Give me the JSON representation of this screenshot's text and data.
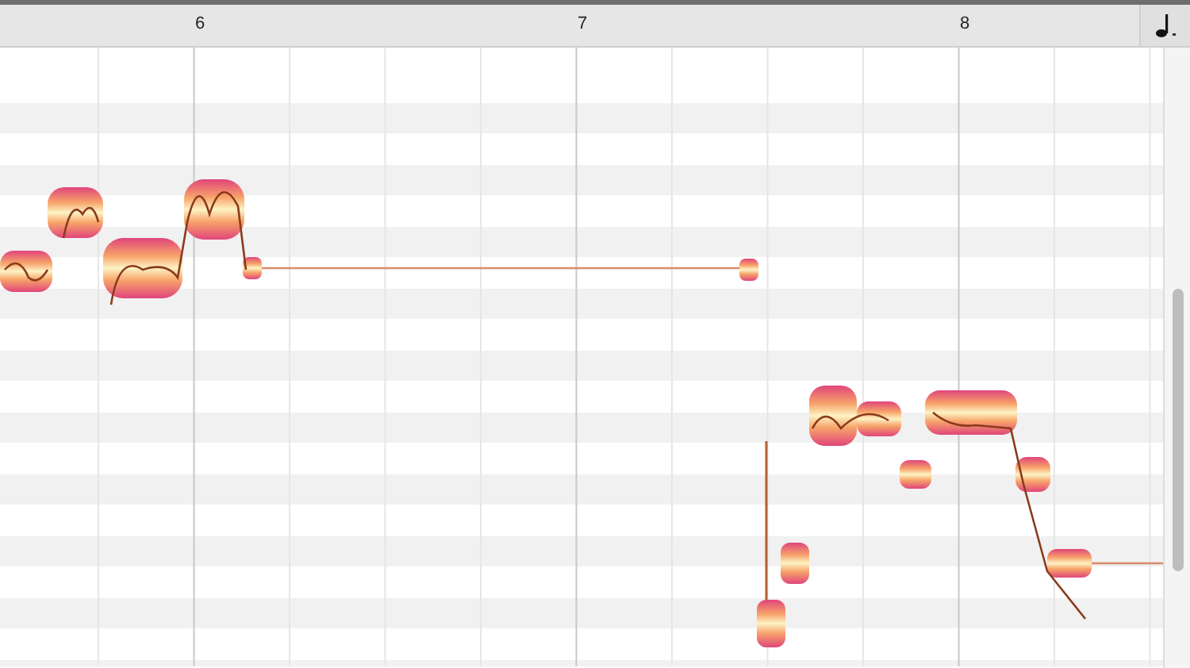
{
  "ruler": {
    "bars": [
      {
        "label": "6"
      },
      {
        "label": "7"
      },
      {
        "label": "8"
      }
    ]
  }
}
